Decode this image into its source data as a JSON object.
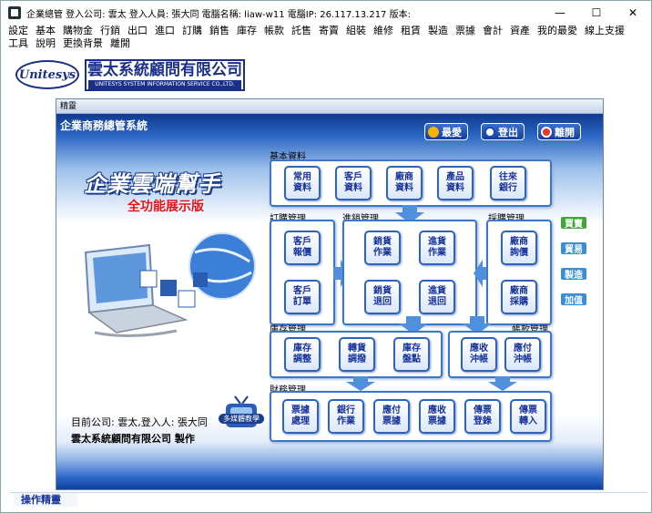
{
  "titlebar": {
    "text": "企業總管  登入公司: 雲太  登入人員: 張大同  電腦名稱: liaw-w11  電腦IP: 26.117.13.217   版本:",
    "minimize": "—",
    "maximize": "☐",
    "close": "✕"
  },
  "menu": {
    "row1": [
      "設定",
      "基本",
      "購物金",
      "行銷",
      "出口",
      "進口",
      "訂購",
      "銷售",
      "庫存",
      "帳款",
      "託售",
      "寄賣",
      "組裝",
      "維修",
      "租賃",
      "製造",
      "票據",
      "會計",
      "資產",
      "我的最愛",
      "線上支援"
    ],
    "row2": [
      "工具",
      "說明",
      "更換背景",
      "離開"
    ]
  },
  "logo": {
    "oval_text": "Unitesys",
    "oval_small": "雲太系統",
    "company_cn": "雲太系統顧問有限公司",
    "company_en": "UNITESYS SYSTEM INFORMATION SERVICE CO.,LTD."
  },
  "panel": {
    "header": "精靈",
    "system_title": "企業商務總管系統",
    "buttons": {
      "favorite": "最愛",
      "logout": "登出",
      "exit": "離開"
    },
    "hero_title": "企業雲端幫手",
    "hero_subtitle": "全功能展示版"
  },
  "sections": {
    "basic": {
      "label": "基本資料",
      "tiles": [
        "常用\n資料",
        "客戶\n資料",
        "廠商\n資料",
        "產品\n資料",
        "往來\n銀行"
      ]
    },
    "order": {
      "label": "訂購管理",
      "tiles": [
        "客戶\n報價",
        "客戶\n訂單"
      ]
    },
    "sales": {
      "label": "進銷管理",
      "tiles": [
        "銷貨\n作業",
        "進貨\n作業",
        "銷貨\n退回",
        "進貨\n退回"
      ]
    },
    "purchase": {
      "label": "採購管理",
      "tiles": [
        "廠商\n詢價",
        "廠商\n採購"
      ]
    },
    "inventory": {
      "label": "庫存管理",
      "tiles": [
        "庫存\n調整",
        "轉貨\n調撥",
        "庫存\n盤點"
      ]
    },
    "accounts": {
      "label": "帳款管理",
      "tiles": [
        "應收\n沖帳",
        "應付\n沖帳"
      ]
    },
    "finance": {
      "label": "財務管理",
      "tiles": [
        "票據\n處理",
        "銀行\n作業",
        "應付\n票據",
        "應收\n票據",
        "傳票\n登錄",
        "傳票\n轉入"
      ]
    }
  },
  "side_buttons": [
    {
      "label": "買賣",
      "color": "#3fa63a"
    },
    {
      "label": "貿易",
      "color": "#3a8fd8"
    },
    {
      "label": "製造",
      "color": "#3a8fd8"
    },
    {
      "label": "加值",
      "color": "#3a8fd8"
    }
  ],
  "footer": {
    "current": "目前公司: 雲太,登入人: 張大同",
    "company_make": "雲太系統顧問有限公司  製作",
    "tv_label": "多媒體教學"
  },
  "status": {
    "tab": "操作精靈"
  },
  "colors": {
    "accent": "#16339a",
    "tile_border": "#2f63b5",
    "red_sub": "#e0141c"
  }
}
